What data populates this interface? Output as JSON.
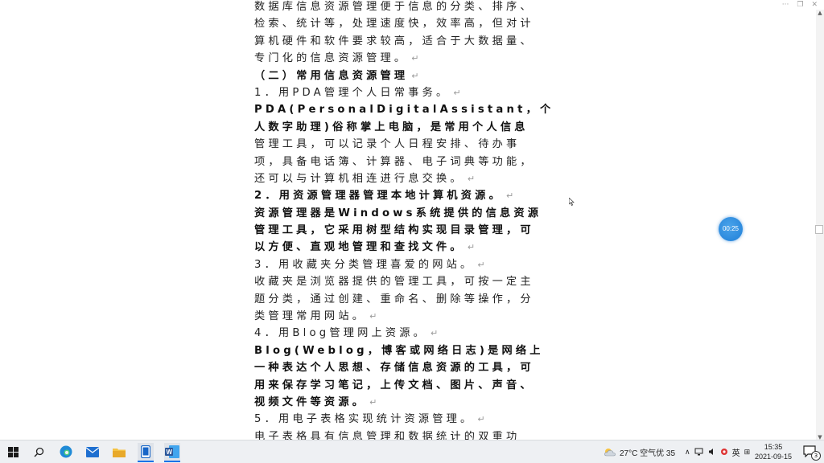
{
  "window": {
    "more_glyph": "···",
    "restore_glyph": "❐",
    "close_glyph": "✕"
  },
  "document": {
    "paragraph_mark": "↵",
    "lines": [
      {
        "text": "数据库信息资源管理便于信息的分类、排序、",
        "bold": false,
        "mark": false
      },
      {
        "text": "检索、统计等，处理速度快，效率高，但对计",
        "bold": false,
        "mark": false
      },
      {
        "text": "算机硬件和软件要求较高，适合于大数据量、",
        "bold": false,
        "mark": false
      },
      {
        "text": "专门化的信息资源管理。",
        "bold": false,
        "mark": true
      },
      {
        "text": "（二）常用信息资源管理",
        "bold": true,
        "mark": true
      },
      {
        "text": "1．用PDA管理个人日常事务。",
        "bold": false,
        "mark": true
      },
      {
        "text": "PDA(PersonalDigitalAssistant，个",
        "bold": true,
        "mark": false
      },
      {
        "text": "人数字助理)俗称掌上电脑，是常用个人信息",
        "bold": true,
        "mark": false
      },
      {
        "text": "管理工具，可以记录个人日程安排、待办事",
        "bold": false,
        "mark": false
      },
      {
        "text": "项，具备电话簿、计算器、电子词典等功能，",
        "bold": false,
        "mark": false
      },
      {
        "text": "还可以与计算机相连进行息交换。",
        "bold": false,
        "mark": true
      },
      {
        "text": "2．用资源管理器管理本地计算机资源。",
        "bold": true,
        "mark": true
      },
      {
        "text": "资源管理器是Windows系统提供的信息资源",
        "bold": true,
        "mark": false
      },
      {
        "text": "管理工具，它采用树型结构实现目录管理，可",
        "bold": true,
        "mark": false
      },
      {
        "text": "以方便、直观地管理和查找文件。",
        "bold": true,
        "mark": true
      },
      {
        "text": "3．用收藏夹分类管理喜爱的网站。",
        "bold": false,
        "mark": true
      },
      {
        "text": "收藏夹是浏览器提供的管理工具，可按一定主",
        "bold": false,
        "mark": false
      },
      {
        "text": "题分类，通过创建、重命名、删除等操作，分",
        "bold": false,
        "mark": false
      },
      {
        "text": "类管理常用网站。",
        "bold": false,
        "mark": true
      },
      {
        "text": "4．用Blog管理网上资源。",
        "bold": false,
        "mark": true
      },
      {
        "text": "Blog(Weblog，博客或网络日志)是网络上",
        "bold": true,
        "mark": false
      },
      {
        "text": "一种表达个人思想、存储信息资源的工具，可",
        "bold": true,
        "mark": false
      },
      {
        "text": "用来保存学习笔记，上传文档、图片、声音、",
        "bold": true,
        "mark": false
      },
      {
        "text": "视频文件等资源。",
        "bold": true,
        "mark": true
      },
      {
        "text": "5．用电子表格实现统计资源管理。",
        "bold": false,
        "mark": true
      },
      {
        "text": "电子表格具有信息管理和数据统计的双重功",
        "bold": false,
        "mark": false
      }
    ]
  },
  "timer": {
    "label": "00:25"
  },
  "taskbar": {
    "weather": "27°C  空气优 35",
    "ime": "英",
    "time": "15:35",
    "date": "2021-09-15",
    "notification_count": "3",
    "colors": {
      "edge": "#1f8ad6",
      "word": "#2b579a",
      "explorer": "#f5c242",
      "mail": "#1e6fd0"
    }
  }
}
